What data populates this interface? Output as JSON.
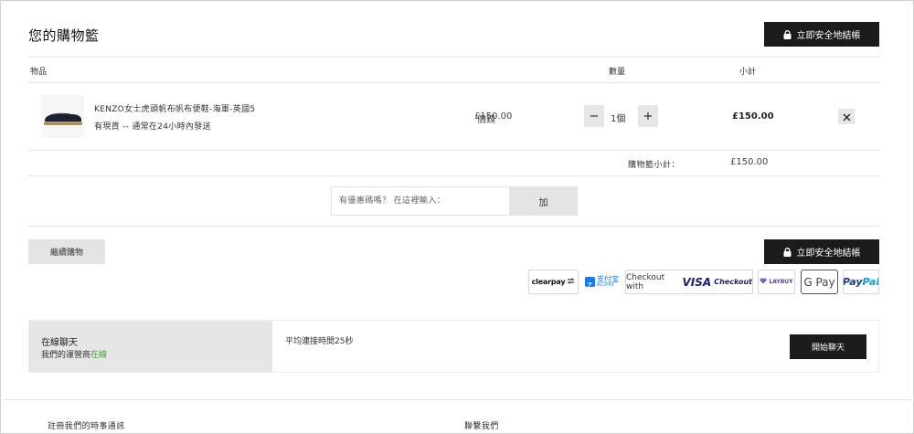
{
  "header": {
    "title": "您的購物籃",
    "checkout_label": "立即安全地結帳"
  },
  "table_headers": {
    "item": "物品",
    "price": "價錢",
    "quantity": "數量",
    "subtotal": "小計"
  },
  "cart_item": {
    "name": "KENZO女士虎頭帆布帆布便鞋-海軍-英國5",
    "stock": "有現貨 -- 通常在24小時內發送",
    "price": "£150.00",
    "quantity": "1個",
    "minus_label": "−",
    "plus_label": "+",
    "line_total": "£150.00",
    "remove_icon": "close-icon"
  },
  "summary": {
    "label": "購物籃小計：",
    "value": "£150.00"
  },
  "coupon": {
    "placeholder": "有優惠碼嗎？ 在這裡輸入：",
    "button_label": "加"
  },
  "actions": {
    "continue_label": "繼續購物",
    "checkout_label": "立即安全地結帳"
  },
  "payment_methods": {
    "clearpay": "clearpay",
    "alipay_cn": "支付宝",
    "alipay_en": "ALIPAY",
    "visa_prefix": "Checkout with",
    "visa_brand": "VISA",
    "visa_suffix": "Checkout",
    "laybuy": "LAYBUY",
    "gpay": "G Pay",
    "paypal_pay": "Pay",
    "paypal_pal": "Pal"
  },
  "chat": {
    "title": "在線聊天",
    "status_prefix": "我們的運營商",
    "status_online": "在線",
    "wait_text": "平均連接時間25秒",
    "button_label": "開始聊天"
  },
  "footer": {
    "newsletter": "註冊我們的時事通訊",
    "contact": "聯繫我們"
  },
  "colors": {
    "primary_button": "#1b1b1b",
    "secondary_button": "#e4e4e4",
    "online": "#3c9f2e",
    "paypal_dark": "#253b80",
    "paypal_light": "#179bd7",
    "alipay": "#1677ff"
  }
}
